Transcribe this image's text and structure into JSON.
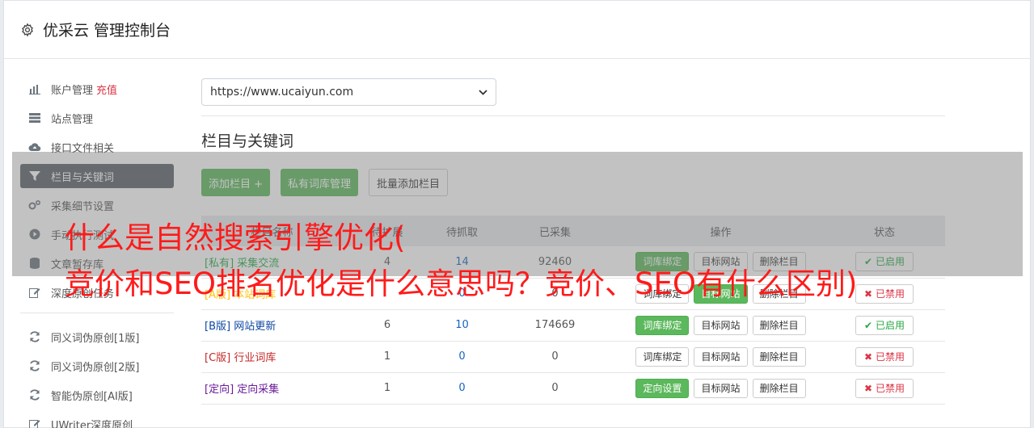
{
  "app": {
    "title": "优采云 管理控制台",
    "icon": "gear-icon"
  },
  "sidebar": {
    "items": [
      {
        "label": "账户管理",
        "extra": "充值",
        "icon": "bar-chart-icon"
      },
      {
        "label": "站点管理",
        "icon": "server-icon"
      },
      {
        "label": "接口文件相关",
        "icon": "cloud-upload-icon"
      },
      {
        "label": "栏目与关键词",
        "icon": "filter-icon",
        "active": true
      },
      {
        "label": "采集细节设置",
        "icon": "cogs-icon"
      },
      {
        "label": "手动执行测试",
        "icon": "play-circle-icon"
      },
      {
        "label": "文章暂存库",
        "icon": "database-icon"
      },
      {
        "label": "深度原创任务",
        "icon": "edit-icon"
      }
    ],
    "items2": [
      {
        "label": "同义词伪原创[1版]",
        "icon": "refresh-icon"
      },
      {
        "label": "同义词伪原创[2版]",
        "icon": "refresh-icon"
      },
      {
        "label": "智能伪原创[AI版]",
        "icon": "refresh-icon"
      },
      {
        "label": "UWriter深度原创",
        "icon": "edit-icon"
      }
    ]
  },
  "main": {
    "site_select": {
      "value": "https://www.ucaiyun.com"
    },
    "section_title": "栏目与关键词",
    "buttons": {
      "add_column": "添加栏目 +",
      "private_lib": "私有词库管理",
      "batch_add": "批量添加栏目"
    },
    "table": {
      "headers": [
        "栏目名称",
        "待扩展",
        "待抓取",
        "已采集",
        "操作",
        "状态"
      ],
      "rows": [
        {
          "tag": "[私有]",
          "name": "采集交流",
          "c1": "4",
          "c2": "14",
          "c3": "92460",
          "op1": "词库绑定",
          "op2": "目标网站",
          "op3": "删除栏目",
          "status": "已启用"
        },
        {
          "tag": "[A版]",
          "name": "本站词库",
          "c1": "",
          "c2": "0",
          "c3": "0",
          "op1": "词库绑定",
          "op2": "目标网站",
          "op3": "删除栏目",
          "status": "已禁用"
        },
        {
          "tag": "[B版]",
          "name": "网站更新",
          "c1": "6",
          "c2": "10",
          "c3": "174669",
          "op1": "词库绑定",
          "op2": "目标网站",
          "op3": "删除栏目",
          "status": "已启用"
        },
        {
          "tag": "[C版]",
          "name": "行业词库",
          "c1": "1",
          "c2": "0",
          "c3": "0",
          "op1": "词库绑定",
          "op2": "目标网站",
          "op3": "删除栏目",
          "status": "已禁用"
        },
        {
          "tag": "[定向]",
          "name": "定向采集",
          "c1": "1",
          "c2": "0",
          "c3": "0",
          "op1": "定向设置",
          "op2": "目标网站",
          "op3": "删除栏目",
          "status": "已禁用"
        }
      ]
    }
  },
  "overlay_text": {
    "line1": "什么是自然搜索引擎优化(",
    "line2": "竞价和SEO排名优化是什么意思吗？竞价、SEO有什么区别)"
  },
  "colors": {
    "accent_green": "#5cb85c",
    "active_sidebar": "#5a6268",
    "headline_red": "#ff1a1a"
  }
}
